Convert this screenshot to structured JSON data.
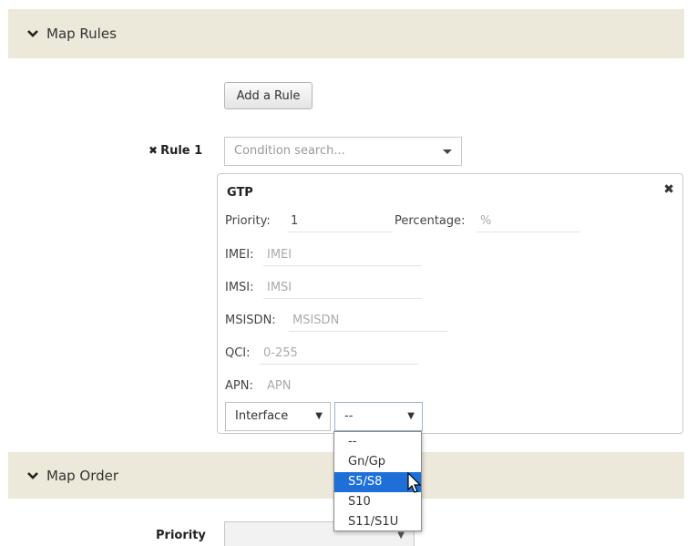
{
  "map_rules": {
    "title": "Map Rules",
    "add_rule_label": "Add a Rule",
    "rule": {
      "remove_glyph": "✖",
      "label": "Rule 1",
      "condition_placeholder": "Condition search..."
    },
    "gtp": {
      "title": "GTP",
      "close_glyph": "✖",
      "priority_label": "Priority:",
      "priority_value": "1",
      "percentage_label": "Percentage:",
      "percentage_placeholder": "%",
      "imei_label": "IMEI:",
      "imei_placeholder": "IMEI",
      "imsi_label": "IMSI:",
      "imsi_placeholder": "IMSI",
      "msisdn_label": "MSISDN:",
      "msisdn_placeholder": "MSISDN",
      "qci_label": "QCI:",
      "qci_placeholder": "0-255",
      "apn_label": "APN:",
      "apn_placeholder": "APN",
      "interface_select": "Interface",
      "interface_value": "--",
      "interface_options": [
        "--",
        "Gn/Gp",
        "S5/S8",
        "S10",
        "S11/S1U"
      ],
      "highlighted_option": "S5/S8"
    }
  },
  "map_order": {
    "title": "Map Order",
    "priority_label": "Priority"
  },
  "colors": {
    "section_bar": "#ece8da",
    "highlight": "#1e6fd8"
  }
}
